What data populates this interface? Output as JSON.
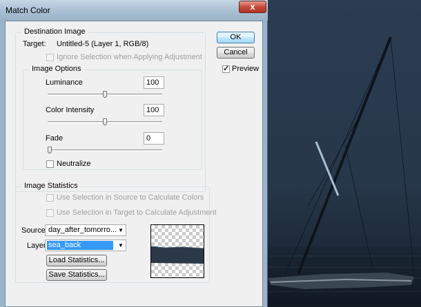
{
  "window": {
    "title": "Match Color",
    "close_glyph": "x"
  },
  "destination": {
    "group_title": "Destination Image",
    "target_label": "Target:",
    "target_value": "Untitled-5 (Layer 1, RGB/8)",
    "ignore_selection_label": "Ignore Selection when Applying Adjustment",
    "ignore_selection_checked": false
  },
  "image_options": {
    "group_title": "Image Options",
    "luminance": {
      "label": "Luminance",
      "value": "100",
      "slider_fraction": 0.5
    },
    "color_intensity": {
      "label": "Color Intensity",
      "value": "100",
      "slider_fraction": 0.5
    },
    "fade": {
      "label": "Fade",
      "value": "0",
      "slider_fraction": 0.0
    },
    "neutralize_label": "Neutralize",
    "neutralize_checked": false
  },
  "image_statistics": {
    "group_title": "Image Statistics",
    "use_selection_source_label": "Use Selection in Source to Calculate Colors",
    "use_selection_target_label": "Use Selection in Target to Calculate Adjustment",
    "source_label": "Source:",
    "source_value": "day_after_tomorro...",
    "layer_label": "Layer:",
    "layer_value": "sea_back",
    "load_button": "Load Statistics...",
    "save_button": "Save Statistics..."
  },
  "buttons": {
    "ok": "OK",
    "cancel": "Cancel"
  },
  "preview": {
    "label": "Preview",
    "checked": true
  },
  "icons": {
    "close": "close-icon",
    "dropdown": "chevron-down-icon",
    "checkmark": "check-icon"
  }
}
